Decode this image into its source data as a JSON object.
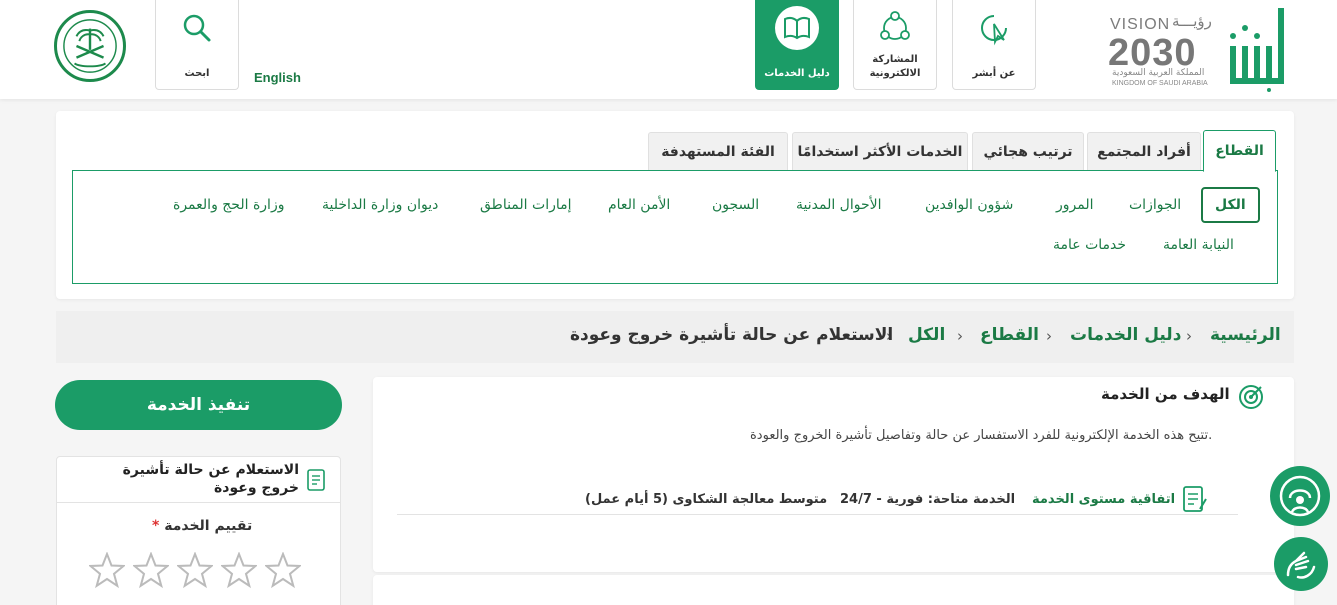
{
  "header": {
    "search_label": "ابحث",
    "language_link": "English",
    "guide_label": "دليل الخدمات",
    "participation_label_line1": "المشاركة",
    "participation_label_line2": "الالكترونية",
    "about_label": "عن أبشر",
    "vision_word": "VISION",
    "vision_arabic": "رؤيـــة",
    "vision_year": "2030",
    "kingdom_ar": "المملكة العربية السعودية",
    "kingdom_en": "KINGDOM OF SAUDI ARABIA",
    "accent_color": "#1b9c67"
  },
  "tabs": [
    {
      "label": "القطاع",
      "active": true
    },
    {
      "label": "أفراد المجتمع",
      "active": false
    },
    {
      "label": "ترتيب هجائي",
      "active": false
    },
    {
      "label": "الخدمات الأكثر استخدامًا",
      "active": false
    },
    {
      "label": "الفئة المستهدفة",
      "active": false
    }
  ],
  "sectors": [
    {
      "label": "الكل",
      "active": true
    },
    {
      "label": "الجوازات"
    },
    {
      "label": "المرور"
    },
    {
      "label": "شؤون الوافدين"
    },
    {
      "label": "الأحوال المدنية"
    },
    {
      "label": "السجون"
    },
    {
      "label": "الأمن العام"
    },
    {
      "label": "إمارات المناطق"
    },
    {
      "label": "ديوان وزارة الداخلية"
    },
    {
      "label": "وزارة الحج والعمرة"
    },
    {
      "label": "النيابة العامة"
    },
    {
      "label": "خدمات عامة"
    }
  ],
  "breadcrumb": {
    "home": "الرئيسية",
    "guide": "دليل الخدمات",
    "sector": "القطاع",
    "all": "الكل",
    "current": "الاستعلام عن حالة تأشيرة خروج وعودة"
  },
  "service": {
    "goal_title": "الهدف من الخدمة",
    "goal_text": "تتيح هذه الخدمة الإلكترونية للفرد الاستفسار عن حالة وتفاصيل تأشيرة الخروج والعودة.",
    "sla_title": "اتفاقية مستوى الخدمة",
    "availability": "الخدمة متاحة: فورية - 24/7",
    "complaint_time": "متوسط معالجة الشكاوى (5 أيام عمل)"
  },
  "side": {
    "execute_button": "تنفيذ الخدمة",
    "service_name": "الاستعلام عن حالة تأشيرة خروج وعودة",
    "rating_label": "تقييم الخدمة",
    "required_mark": "*",
    "rating_value": 0,
    "rating_max": 5
  }
}
